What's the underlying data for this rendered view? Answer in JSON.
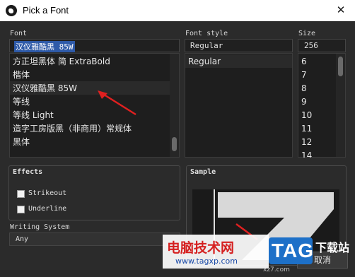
{
  "window": {
    "title": "Pick a Font",
    "close_glyph": "✕"
  },
  "font": {
    "label": "Font",
    "input_value": "汉仪雅酷黑 85W",
    "items": [
      "方正坦黑体 简 ExtraBold",
      "楷体",
      "汉仪雅酷黑 85W",
      "等线",
      "等线 Light",
      "造字工房版黑（非商用）常规体",
      "黑体"
    ],
    "selected_index": 2
  },
  "font_style": {
    "label": "Font style",
    "input_value": "Regular",
    "items": [
      "Regular"
    ]
  },
  "size": {
    "label": "Size",
    "input_value": "256",
    "items": [
      "6",
      "7",
      "8",
      "9",
      "10",
      "11",
      "12",
      "14"
    ]
  },
  "effects": {
    "label": "Effects",
    "strikeout_label": "Strikeout",
    "underline_label": "Underline"
  },
  "sample": {
    "label": "Sample"
  },
  "writing_system": {
    "label": "Writing System",
    "value": "Any"
  },
  "footer": {
    "cancel_label": "取消"
  },
  "watermark": {
    "site_title": "电脑技术网",
    "site_url": "www.tagxp.com",
    "tag_text": "TAG",
    "download_text": "下载站",
    "url_tail": "xz7.com"
  }
}
